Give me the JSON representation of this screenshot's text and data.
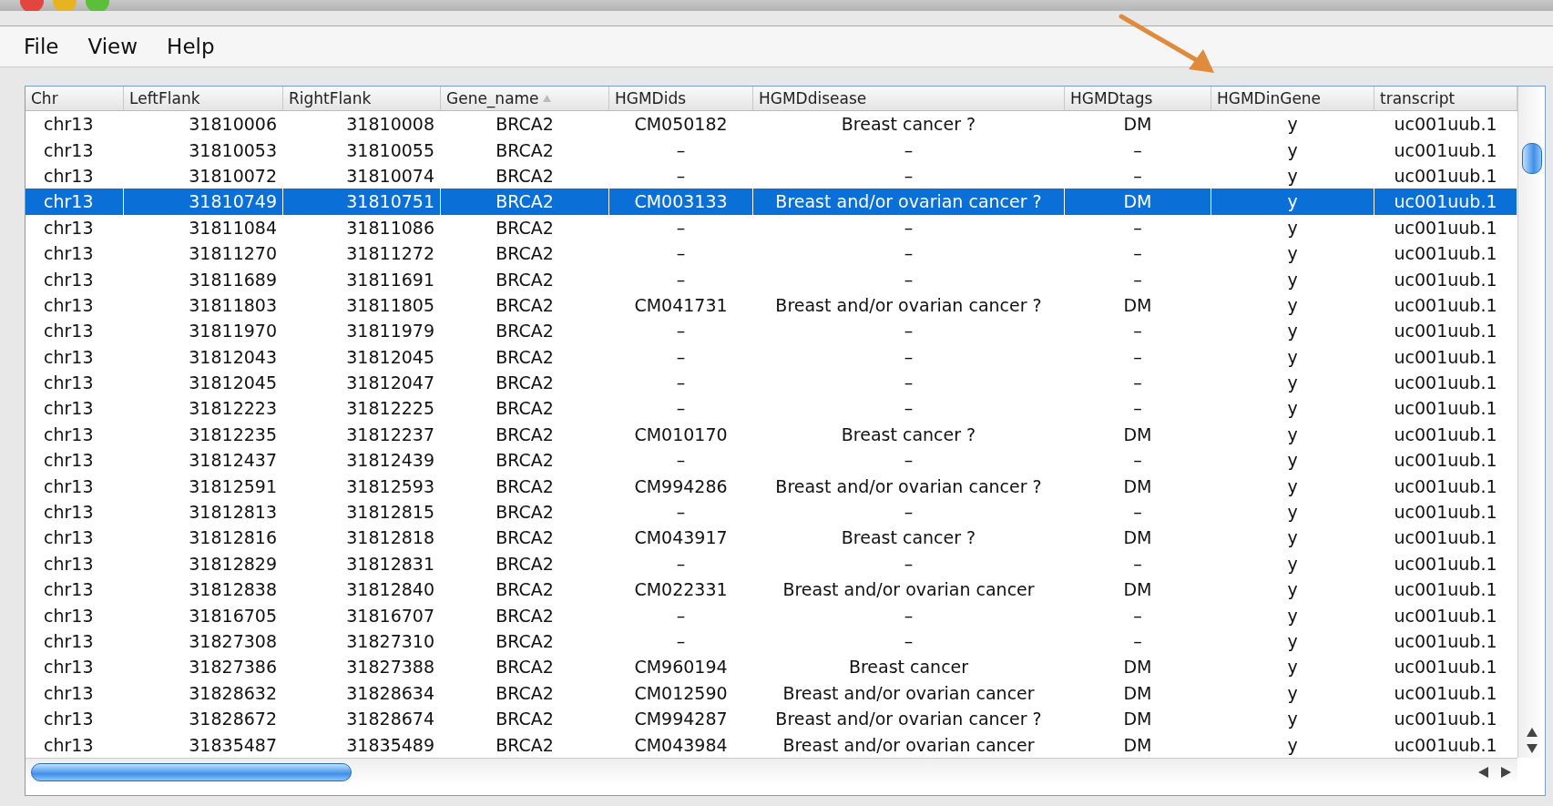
{
  "menu": [
    "File",
    "View",
    "Help"
  ],
  "table": {
    "columns": [
      {
        "label": "Chr",
        "sorted": false
      },
      {
        "label": "LeftFlank",
        "sorted": false
      },
      {
        "label": "RightFlank",
        "sorted": false
      },
      {
        "label": "Gene_name",
        "sorted": true
      },
      {
        "label": "HGMDids",
        "sorted": false
      },
      {
        "label": "HGMDdisease",
        "sorted": false
      },
      {
        "label": "HGMDtags",
        "sorted": false
      },
      {
        "label": "HGMDinGene",
        "sorted": false
      },
      {
        "label": "transcript",
        "sorted": false
      }
    ],
    "rows": [
      {
        "selected": false,
        "cells": [
          "chr13",
          "31810006",
          "31810008",
          "BRCA2",
          "CM050182",
          "Breast cancer ?",
          "DM",
          "y",
          "uc001uub.1"
        ]
      },
      {
        "selected": false,
        "cells": [
          "chr13",
          "31810053",
          "31810055",
          "BRCA2",
          "–",
          "–",
          "–",
          "y",
          "uc001uub.1"
        ]
      },
      {
        "selected": false,
        "cells": [
          "chr13",
          "31810072",
          "31810074",
          "BRCA2",
          "–",
          "–",
          "–",
          "y",
          "uc001uub.1"
        ]
      },
      {
        "selected": true,
        "cells": [
          "chr13",
          "31810749",
          "31810751",
          "BRCA2",
          "CM003133",
          "Breast and/or ovarian cancer ?",
          "DM",
          "y",
          "uc001uub.1"
        ]
      },
      {
        "selected": false,
        "cells": [
          "chr13",
          "31811084",
          "31811086",
          "BRCA2",
          "–",
          "–",
          "–",
          "y",
          "uc001uub.1"
        ]
      },
      {
        "selected": false,
        "cells": [
          "chr13",
          "31811270",
          "31811272",
          "BRCA2",
          "–",
          "–",
          "–",
          "y",
          "uc001uub.1"
        ]
      },
      {
        "selected": false,
        "cells": [
          "chr13",
          "31811689",
          "31811691",
          "BRCA2",
          "–",
          "–",
          "–",
          "y",
          "uc001uub.1"
        ]
      },
      {
        "selected": false,
        "cells": [
          "chr13",
          "31811803",
          "31811805",
          "BRCA2",
          "CM041731",
          "Breast and/or ovarian cancer ?",
          "DM",
          "y",
          "uc001uub.1"
        ]
      },
      {
        "selected": false,
        "cells": [
          "chr13",
          "31811970",
          "31811979",
          "BRCA2",
          "–",
          "–",
          "–",
          "y",
          "uc001uub.1"
        ]
      },
      {
        "selected": false,
        "cells": [
          "chr13",
          "31812043",
          "31812045",
          "BRCA2",
          "–",
          "–",
          "–",
          "y",
          "uc001uub.1"
        ]
      },
      {
        "selected": false,
        "cells": [
          "chr13",
          "31812045",
          "31812047",
          "BRCA2",
          "–",
          "–",
          "–",
          "y",
          "uc001uub.1"
        ]
      },
      {
        "selected": false,
        "cells": [
          "chr13",
          "31812223",
          "31812225",
          "BRCA2",
          "–",
          "–",
          "–",
          "y",
          "uc001uub.1"
        ]
      },
      {
        "selected": false,
        "cells": [
          "chr13",
          "31812235",
          "31812237",
          "BRCA2",
          "CM010170",
          "Breast cancer ?",
          "DM",
          "y",
          "uc001uub.1"
        ]
      },
      {
        "selected": false,
        "cells": [
          "chr13",
          "31812437",
          "31812439",
          "BRCA2",
          "–",
          "–",
          "–",
          "y",
          "uc001uub.1"
        ]
      },
      {
        "selected": false,
        "cells": [
          "chr13",
          "31812591",
          "31812593",
          "BRCA2",
          "CM994286",
          "Breast and/or ovarian cancer ?",
          "DM",
          "y",
          "uc001uub.1"
        ]
      },
      {
        "selected": false,
        "cells": [
          "chr13",
          "31812813",
          "31812815",
          "BRCA2",
          "–",
          "–",
          "–",
          "y",
          "uc001uub.1"
        ]
      },
      {
        "selected": false,
        "cells": [
          "chr13",
          "31812816",
          "31812818",
          "BRCA2",
          "CM043917",
          "Breast cancer ?",
          "DM",
          "y",
          "uc001uub.1"
        ]
      },
      {
        "selected": false,
        "cells": [
          "chr13",
          "31812829",
          "31812831",
          "BRCA2",
          "–",
          "–",
          "–",
          "y",
          "uc001uub.1"
        ]
      },
      {
        "selected": false,
        "cells": [
          "chr13",
          "31812838",
          "31812840",
          "BRCA2",
          "CM022331",
          "Breast and/or ovarian cancer",
          "DM",
          "y",
          "uc001uub.1"
        ]
      },
      {
        "selected": false,
        "cells": [
          "chr13",
          "31816705",
          "31816707",
          "BRCA2",
          "–",
          "–",
          "–",
          "y",
          "uc001uub.1"
        ]
      },
      {
        "selected": false,
        "cells": [
          "chr13",
          "31827308",
          "31827310",
          "BRCA2",
          "–",
          "–",
          "–",
          "y",
          "uc001uub.1"
        ]
      },
      {
        "selected": false,
        "cells": [
          "chr13",
          "31827386",
          "31827388",
          "BRCA2",
          "CM960194",
          "Breast cancer",
          "DM",
          "y",
          "uc001uub.1"
        ]
      },
      {
        "selected": false,
        "cells": [
          "chr13",
          "31828632",
          "31828634",
          "BRCA2",
          "CM012590",
          "Breast and/or ovarian cancer",
          "DM",
          "y",
          "uc001uub.1"
        ]
      },
      {
        "selected": false,
        "cells": [
          "chr13",
          "31828672",
          "31828674",
          "BRCA2",
          "CM994287",
          "Breast and/or ovarian cancer ?",
          "DM",
          "y",
          "uc001uub.1"
        ]
      },
      {
        "selected": false,
        "cells": [
          "chr13",
          "31835487",
          "31835489",
          "BRCA2",
          "CM043984",
          "Breast and/or ovarian cancer",
          "DM",
          "y",
          "uc001uub.1"
        ]
      }
    ]
  }
}
